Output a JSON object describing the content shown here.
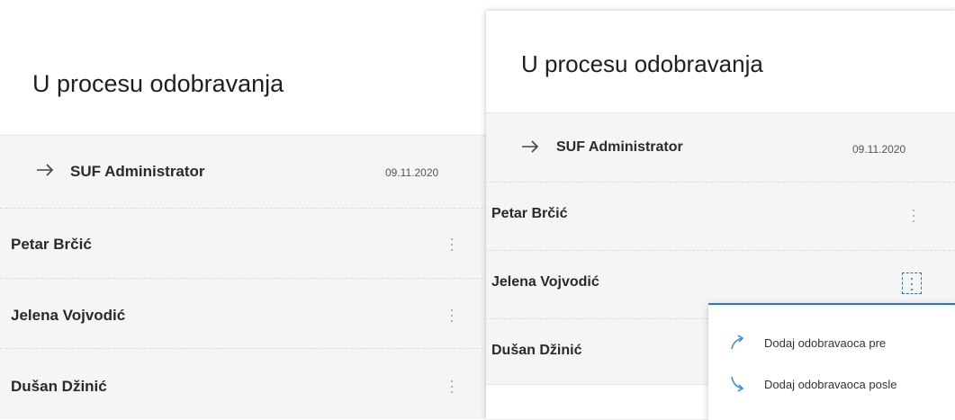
{
  "left_panel": {
    "title": "U procesu odobravanja",
    "current": {
      "name": "SUF Administrator",
      "date": "09.11.2020"
    },
    "approvers": [
      {
        "name": "Petar Brčić"
      },
      {
        "name": "Jelena Vojvodić"
      },
      {
        "name": "Dušan Džinić"
      }
    ]
  },
  "right_panel": {
    "title": "U procesu odobravanja",
    "current": {
      "name": "SUF Administrator",
      "date": "09.11.2020"
    },
    "approvers": [
      {
        "name": "Petar Brčić"
      },
      {
        "name": "Jelena Vojvodić"
      },
      {
        "name": "Dušan Džinić"
      }
    ]
  },
  "menu": {
    "items": [
      {
        "label": "Dodaj odobravaoca pre",
        "icon": "arrow-up-right-icon"
      },
      {
        "label": "Dodaj odobravaoca posle",
        "icon": "arrow-down-right-icon"
      }
    ]
  },
  "colors": {
    "accent": "#1e7bd4",
    "list_bg": "#f4f5f7",
    "text": "#2a2a2a"
  }
}
